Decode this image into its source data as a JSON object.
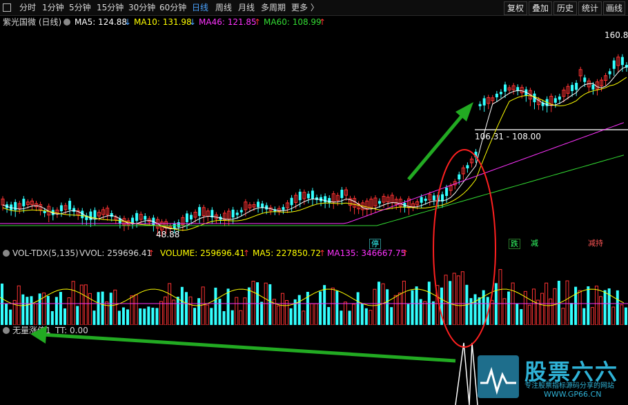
{
  "toolbar": {
    "collapse_icon": "square-icon",
    "periods": [
      "分时",
      "1分钟",
      "5分钟",
      "15分钟",
      "30分钟",
      "60分钟",
      "日线",
      "周线",
      "月线",
      "多周期",
      "更多 〉"
    ],
    "active_period": "日线",
    "tools": [
      "复权",
      "叠加",
      "历史",
      "统计",
      "画线"
    ]
  },
  "main": {
    "stock_title": "紫光国微 (日线)",
    "ma": [
      {
        "label": "MA5: 124.88",
        "arrow": "↓",
        "color": "#ffffff"
      },
      {
        "label": "MA10: 131.98",
        "arrow": "↓",
        "color": "#ffff00"
      },
      {
        "label": "MA46: 121.85",
        "arrow": "↑",
        "color": "#ff33ff"
      },
      {
        "label": "MA60: 108.99",
        "arrow": "↑",
        "color": "#33dd33"
      }
    ],
    "price_labels": {
      "low": "48.88",
      "high": "160.8",
      "range": "106.31 - 108.00"
    },
    "tags": [
      "停",
      "跌",
      "减",
      "减持"
    ]
  },
  "volume": {
    "title": "VOL-TDX(5,135)",
    "vvol": "VVOL: 259696.41",
    "volume": "VOLUME: 259696.41",
    "ma5": "MA5: 227850.72",
    "ma135": "MA135: 346667.75",
    "arrow": "↑"
  },
  "indicator": {
    "label": "无量涨停1",
    "tt": "TT: 0.00"
  },
  "watermark": {
    "title": "股票六六",
    "subtitle": "专注股票指标源码分享的网站",
    "url": "WWW.GP66.CN"
  },
  "colors": {
    "up": "#ff3333",
    "down": "#33ffff",
    "accent": "#4aa3ff",
    "annotation_circle": "#ff2020",
    "arrow": "#22aa22"
  }
}
